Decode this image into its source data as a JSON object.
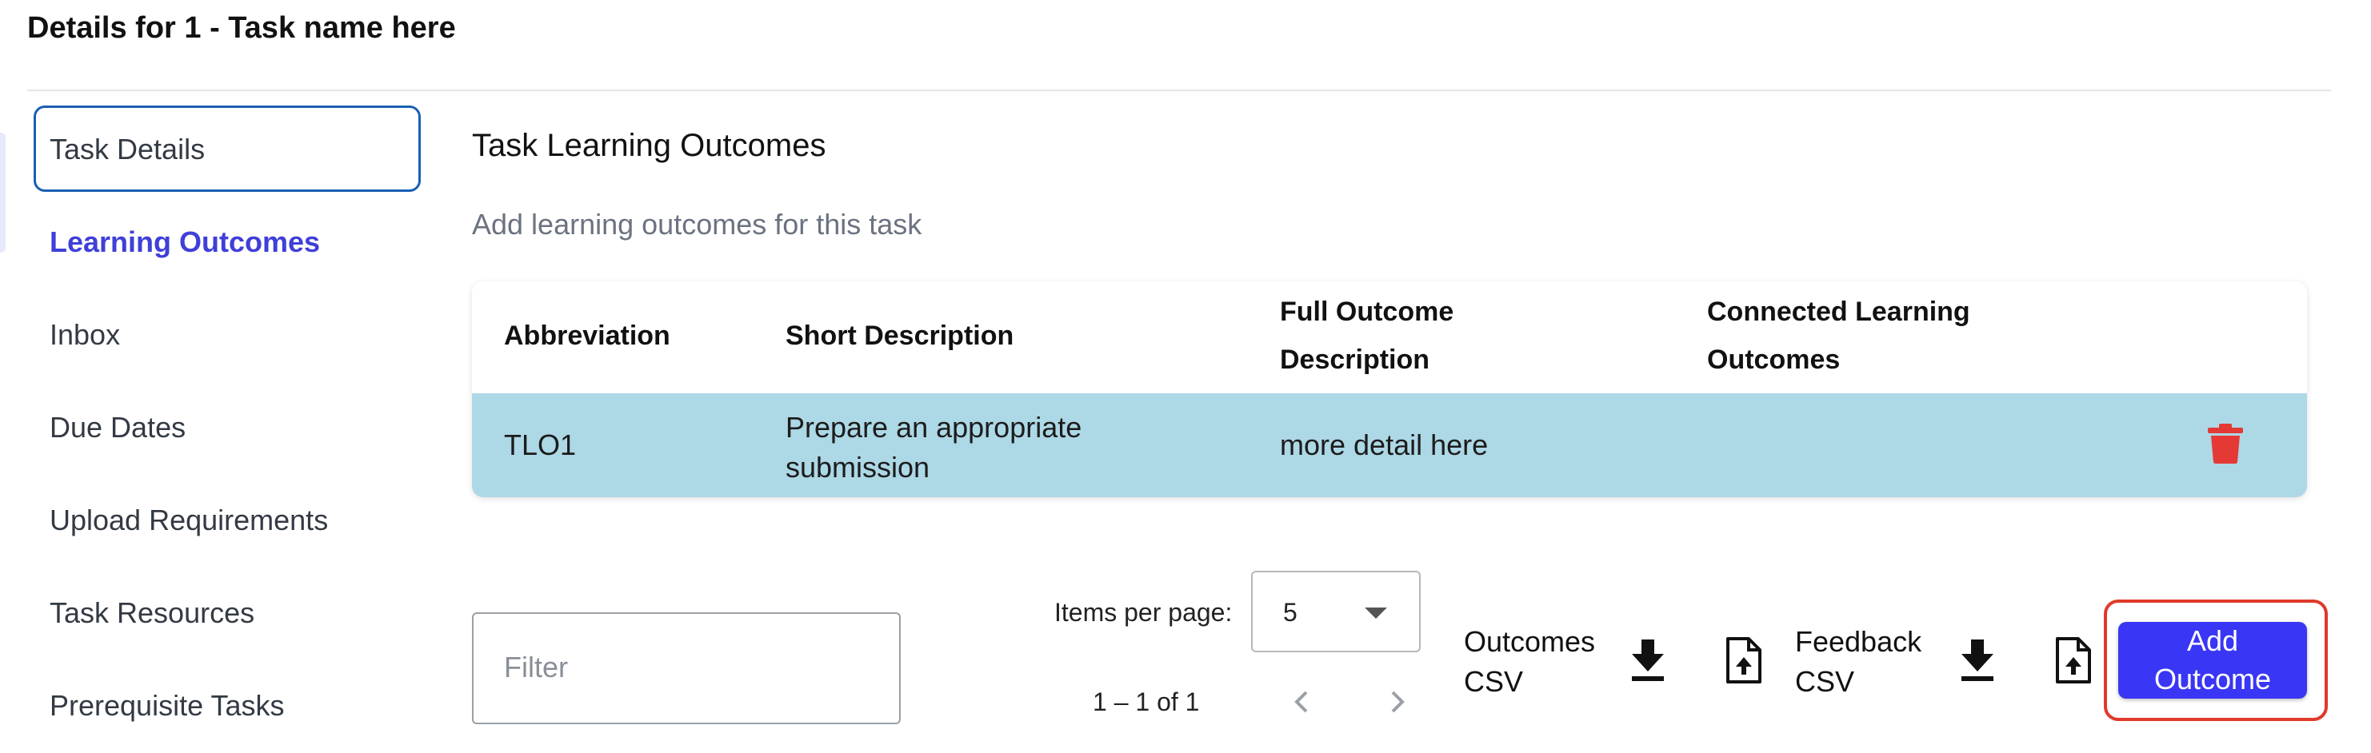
{
  "page": {
    "title": "Details for 1 - Task name here"
  },
  "sidebar": {
    "items": [
      {
        "label": "Task Details"
      },
      {
        "label": "Learning Outcomes"
      },
      {
        "label": "Inbox"
      },
      {
        "label": "Due Dates"
      },
      {
        "label": "Upload Requirements"
      },
      {
        "label": "Task Resources"
      },
      {
        "label": "Prerequisite Tasks"
      }
    ],
    "active": "Learning Outcomes",
    "focused": "Task Details"
  },
  "main": {
    "title": "Task Learning Outcomes",
    "subtitle": "Add learning outcomes for this task",
    "table": {
      "headers": {
        "abbreviation": "Abbreviation",
        "short_description": "Short Description",
        "full_line1": "Full Outcome",
        "full_line2": "Description",
        "connected_line1": "Connected Learning",
        "connected_line2": "Outcomes"
      },
      "rows": [
        {
          "abbreviation": "TLO1",
          "short_line1": "Prepare an appropriate",
          "short_line2": "submission",
          "full": "more detail here",
          "connected": "",
          "delete_icon": "trash-icon"
        }
      ]
    },
    "filter": {
      "placeholder": "Filter"
    },
    "pagination": {
      "items_per_page_label": "Items per page:",
      "items_per_page_value": "5",
      "range": "1 – 1 of 1"
    },
    "toolbar": {
      "outcomes_csv_line1": "Outcomes",
      "outcomes_csv_line2": "CSV",
      "feedback_csv_line1": "Feedback",
      "feedback_csv_line2": "CSV",
      "add_line1": "Add",
      "add_line2": "Outcome"
    }
  },
  "colors": {
    "accent": "#3f3fd9",
    "row_highlight": "#add8e6",
    "delete": "#e53935",
    "add_button": "#3a36f5",
    "focus_ring": "#e03a2a",
    "nav_focus_border": "#1a5fb4"
  }
}
